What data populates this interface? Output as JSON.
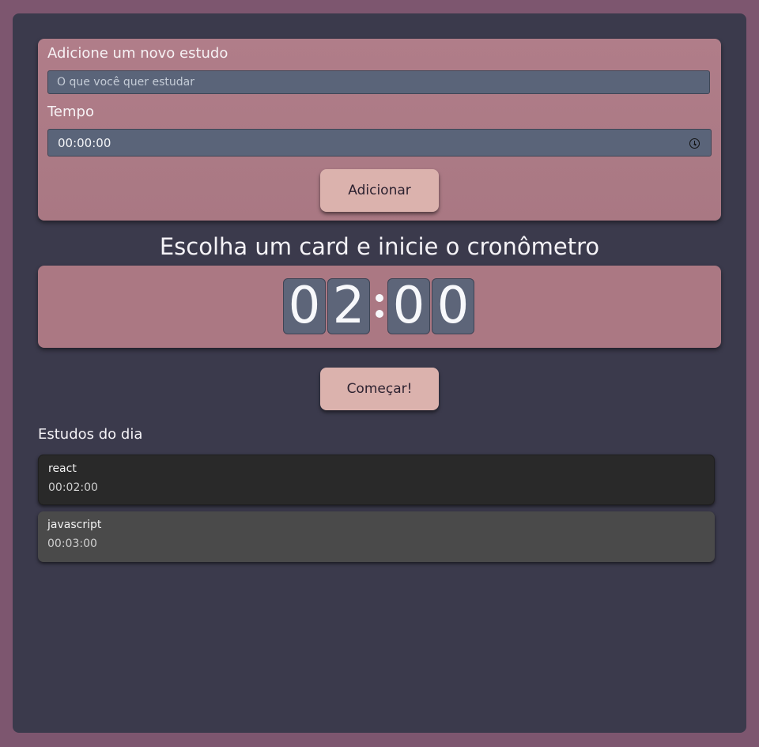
{
  "form": {
    "study_label": "Adicione um novo estudo",
    "study_placeholder": "O que você quer estudar",
    "time_label": "Tempo",
    "time_value": "00:00:00",
    "add_button": "Adicionar"
  },
  "timer": {
    "title": "Escolha um card e inicie o cronômetro",
    "digits": [
      "0",
      "2",
      "0",
      "0"
    ],
    "start_button": "Começar!"
  },
  "list": {
    "title": "Estudos do dia",
    "items": [
      {
        "name": "react",
        "time": "00:02:00",
        "selected": true
      },
      {
        "name": "javascript",
        "time": "00:03:00",
        "selected": false
      }
    ]
  },
  "colors": {
    "page_background": "#7d566f",
    "app_background": "#3b3a4c",
    "card_background": "#ab7883",
    "button_background": "#dbb2ad",
    "input_background": "#5a6479",
    "selected_item": "#292929",
    "item_background": "#4a4a4a"
  },
  "icons": {
    "time_field": "clock-icon"
  }
}
